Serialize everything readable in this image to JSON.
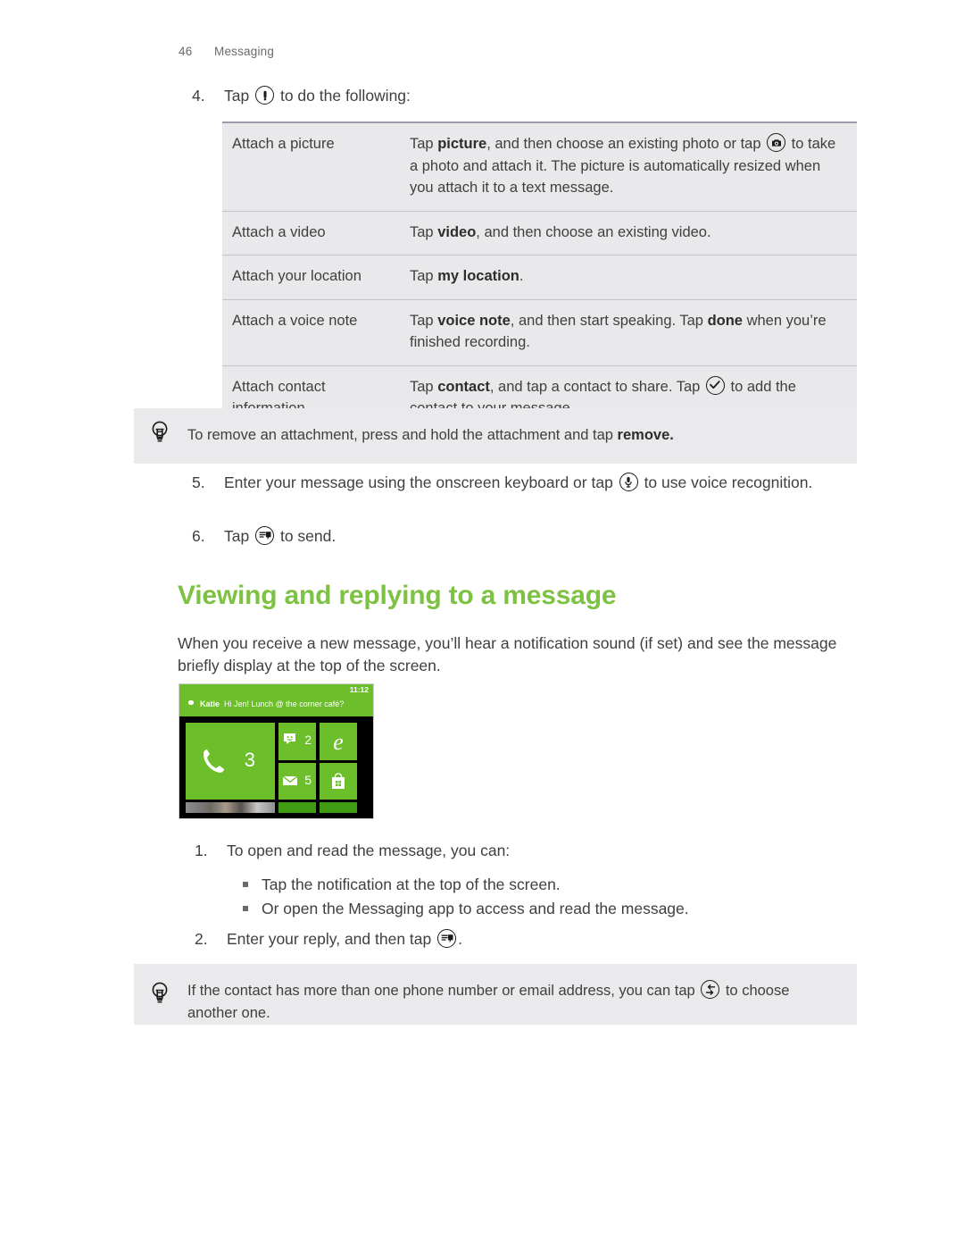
{
  "header": {
    "page_number": "46",
    "section": "Messaging"
  },
  "steps": {
    "s4": {
      "num": "4.",
      "pre": "Tap",
      "icon": "attach-icon",
      "post": "to do the following:"
    },
    "s5": {
      "num": "5.",
      "pre": "Enter your message using the onscreen keyboard or tap",
      "icon": "microphone-icon",
      "post": "to use voice recognition."
    },
    "s6": {
      "num": "6.",
      "pre": "Tap",
      "icon": "send-icon",
      "post": "to send."
    }
  },
  "attach_table": {
    "rows": [
      {
        "label": "Attach a picture",
        "parts": [
          {
            "t": "Tap "
          },
          {
            "b": "picture"
          },
          {
            "t": ", and then choose an existing photo or tap "
          },
          {
            "icon": "camera-icon"
          },
          {
            "t": " to take a photo and attach it. The picture is automatically resized when you attach it to a text message."
          }
        ]
      },
      {
        "label": "Attach a video",
        "parts": [
          {
            "t": "Tap "
          },
          {
            "b": "video"
          },
          {
            "t": ", and then choose an existing video."
          }
        ]
      },
      {
        "label": "Attach your location",
        "parts": [
          {
            "t": "Tap "
          },
          {
            "b": "my location"
          },
          {
            "t": "."
          }
        ]
      },
      {
        "label": "Attach a voice note",
        "parts": [
          {
            "t": "Tap "
          },
          {
            "b": "voice note"
          },
          {
            "t": ", and then start speaking. Tap "
          },
          {
            "b": "done"
          },
          {
            "t": " when you’re finished recording."
          }
        ]
      },
      {
        "label": "Attach contact information",
        "parts": [
          {
            "t": "Tap "
          },
          {
            "b": "contact"
          },
          {
            "t": ", and tap a contact to share. Tap "
          },
          {
            "icon": "check-circle-icon"
          },
          {
            "t": " to add the contact to your message."
          }
        ]
      }
    ]
  },
  "tip_remove": {
    "icon": "lightbulb-icon",
    "parts": [
      {
        "t": "To remove an attachment, press and hold the attachment and tap "
      },
      {
        "b": "remove."
      }
    ]
  },
  "heading": "Viewing and replying to a message",
  "intro": "When you receive a new message, you’ll hear a notification sound (if set) and see the message briefly display at the top of the screen.",
  "phone_screenshot": {
    "time": "11:12",
    "notification_sender": "Katie",
    "notification_text": "Hi Jen! Lunch @ the corner café?",
    "tiles": [
      {
        "name": "phone-tile",
        "icon": "phone-icon",
        "count": "3"
      },
      {
        "name": "messaging-tile",
        "icon": "messaging-icon",
        "count": "2"
      },
      {
        "name": "internet-explorer-tile",
        "icon": "internet-explorer-icon",
        "count": ""
      },
      {
        "name": "mail-tile",
        "icon": "mail-icon",
        "count": "5"
      },
      {
        "name": "store-tile",
        "icon": "store-icon",
        "count": ""
      }
    ],
    "accent_color": "#6cbe2b"
  },
  "read_steps": {
    "s1": {
      "num": "1.",
      "text": "To open and read the message, you can:"
    },
    "bullets": [
      "Tap the notification at the top of the screen.",
      "Or open the Messaging app to access and read the message."
    ],
    "s2": {
      "num": "2.",
      "pre": "Enter your reply, and then tap",
      "icon": "send-icon",
      "post": "."
    }
  },
  "tip_contact": {
    "icon": "lightbulb-icon",
    "parts": [
      {
        "t": "If the contact has more than one phone number or email address, you can tap "
      },
      {
        "icon": "switch-icon"
      },
      {
        "t": " to choose another one."
      }
    ]
  },
  "colors": {
    "heading_green": "#7dc242",
    "table_bg": "#e9e9eb",
    "tip_bg": "#eaeaec"
  }
}
